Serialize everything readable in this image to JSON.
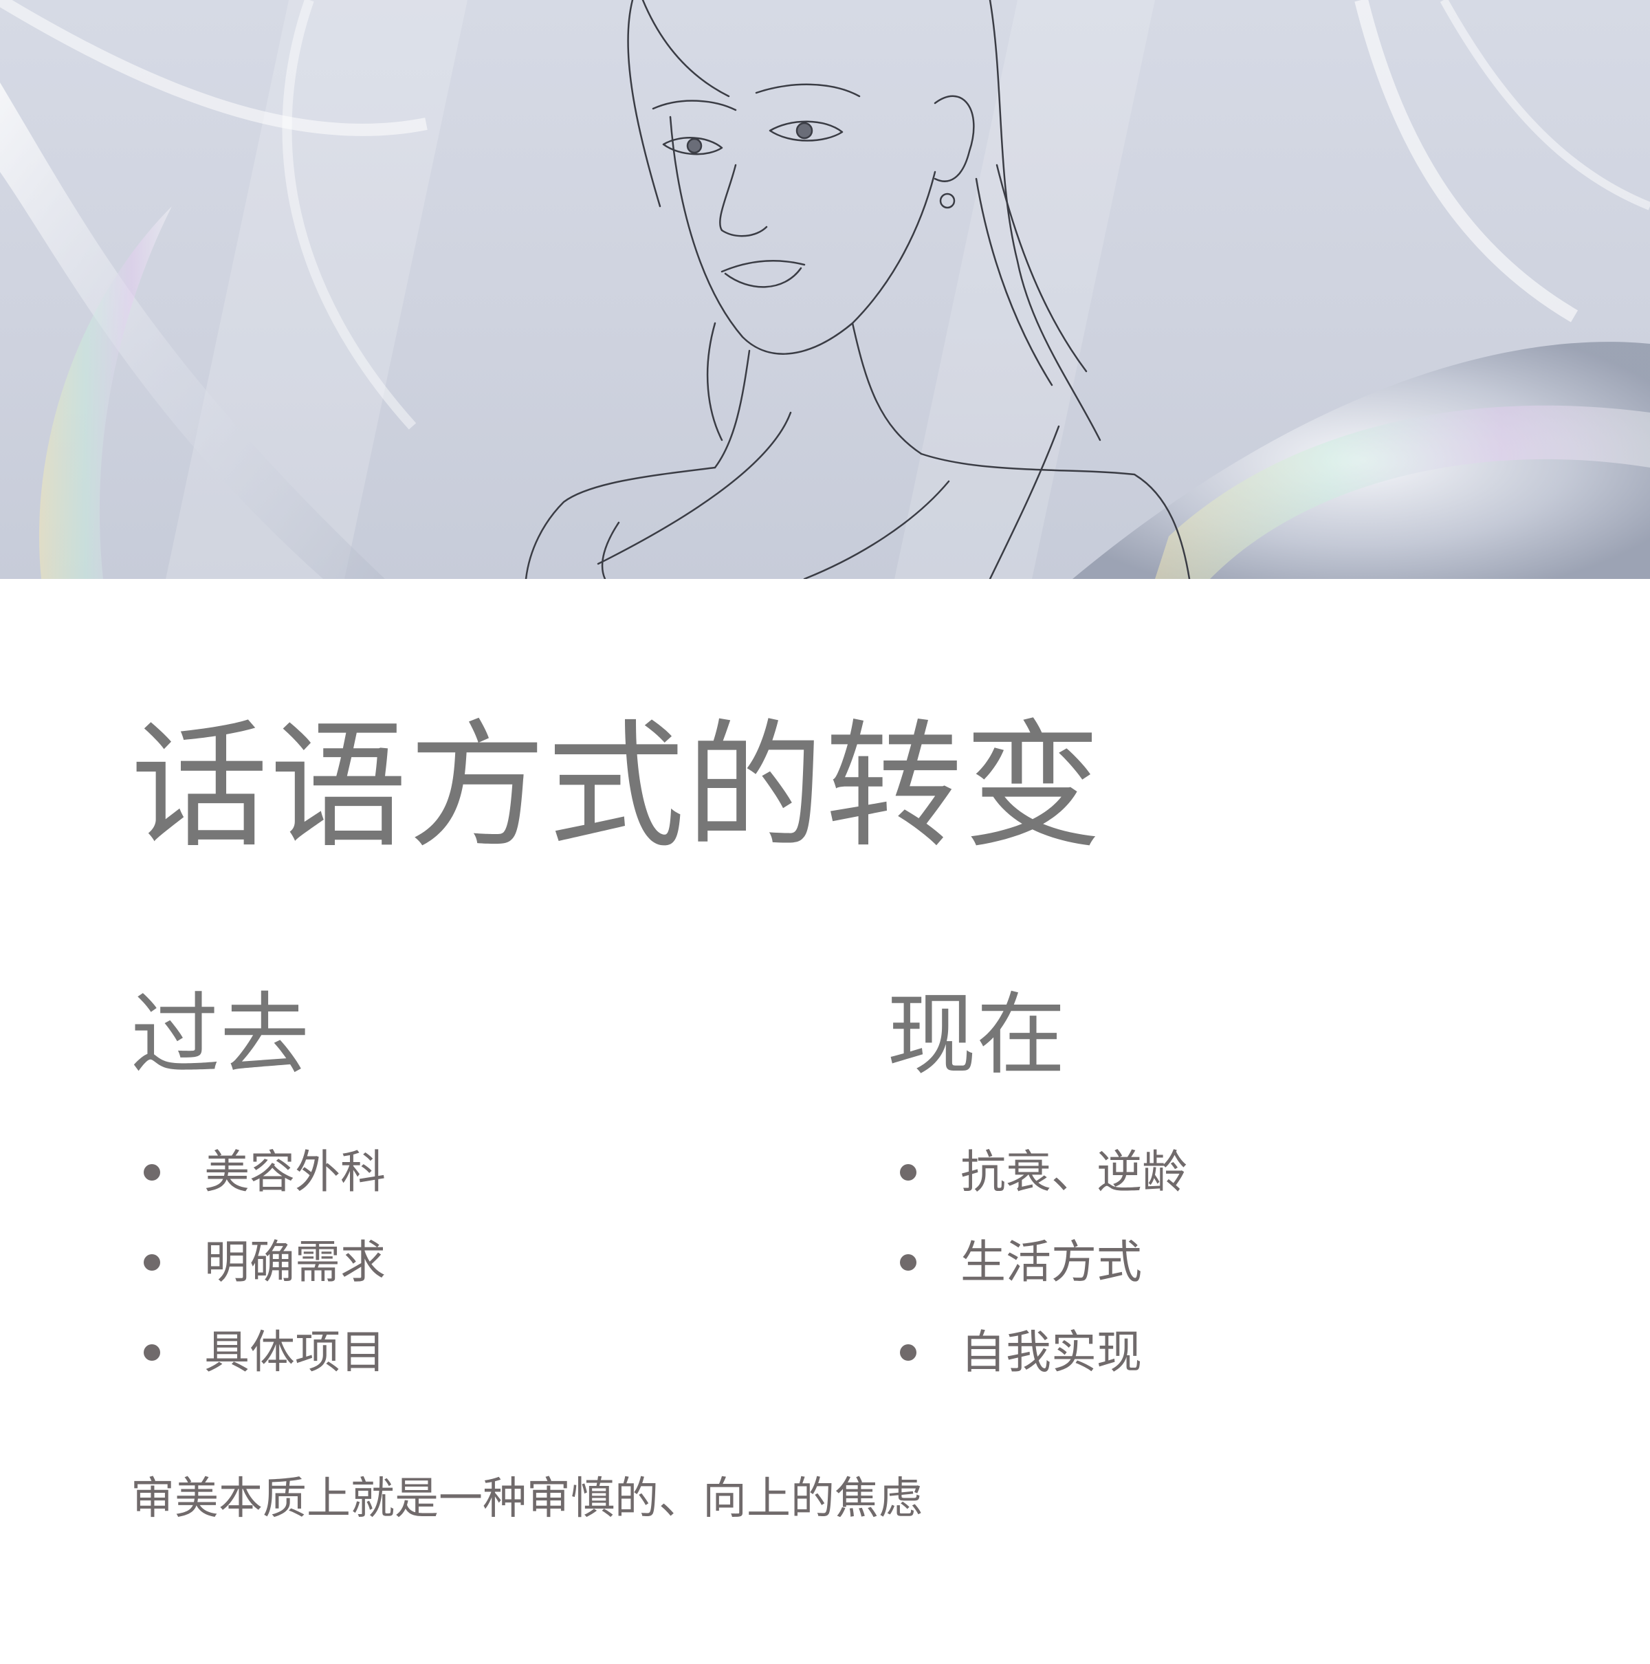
{
  "title": "话语方式的转变",
  "past": {
    "heading": "过去",
    "items": [
      "美容外科",
      "明确需求",
      "具体项目"
    ]
  },
  "present": {
    "heading": "现在",
    "items": [
      "抗衰、逆龄",
      "生活方式",
      "自我实现"
    ]
  },
  "footer_note": "审美本质上就是一种审慎的、向上的焦虑",
  "colors": {
    "title_text": "#777777",
    "body_text": "#706a6b",
    "hero_background": "#d1d5e0",
    "page_background": "#ffffff"
  },
  "hero": {
    "illustration": "line-drawing-woman-portrait",
    "background": "iridescent-glass-swirls"
  }
}
